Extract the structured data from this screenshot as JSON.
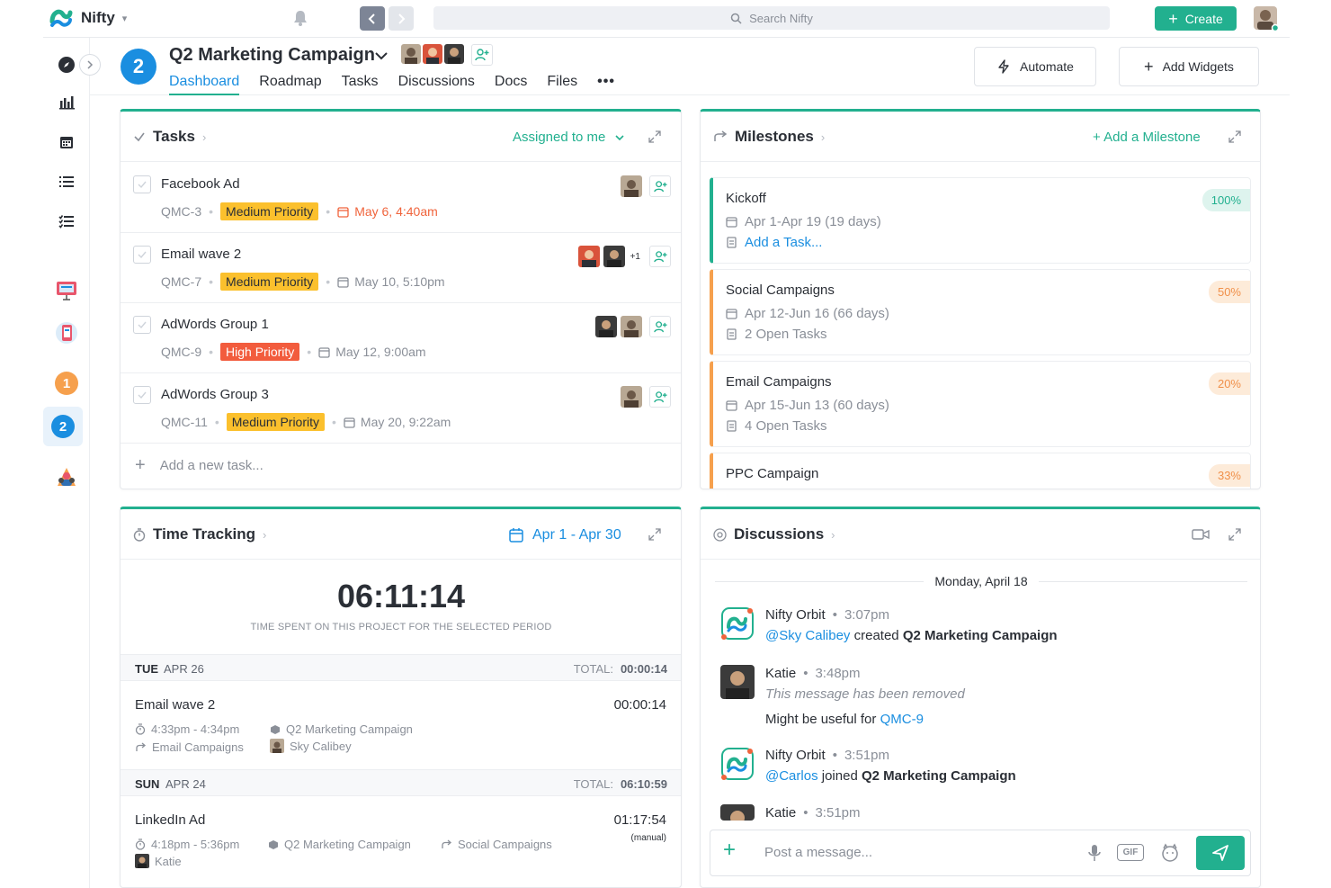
{
  "app": {
    "brand": "Nifty",
    "search_placeholder": "Search Nifty",
    "create_label": "Create"
  },
  "project": {
    "badge": "2",
    "title": "Q2 Marketing Campaign",
    "tabs": [
      "Dashboard",
      "Roadmap",
      "Tasks",
      "Discussions",
      "Docs",
      "Files"
    ],
    "more": "•••",
    "automate_label": "Automate",
    "add_widgets_label": "Add Widgets"
  },
  "sidebar": {
    "project_badge_orange": "1",
    "project_badge_blue": "2"
  },
  "tasks": {
    "title": "Tasks",
    "filter": "Assigned to me",
    "items": [
      {
        "name": "Facebook Ad",
        "id": "QMC-3",
        "priority": "Medium Priority",
        "due": "May 6, 4:40am"
      },
      {
        "name": "Email wave 2",
        "id": "QMC-7",
        "priority": "Medium Priority",
        "due": "May 10, 5:10pm",
        "extra": "+1"
      },
      {
        "name": "AdWords Group 1",
        "id": "QMC-9",
        "priority": "High Priority",
        "due": "May 12, 9:00am"
      },
      {
        "name": "AdWords Group 3",
        "id": "QMC-11",
        "priority": "Medium Priority",
        "due": "May 20, 9:22am"
      }
    ],
    "add_task": "Add a new task..."
  },
  "milestones": {
    "title": "Milestones",
    "add_label": "+ Add a Milestone",
    "items": [
      {
        "name": "Kickoff",
        "dates": "Apr 1-Apr 19 (19 days)",
        "tasks": "Add a Task...",
        "pct": "100%"
      },
      {
        "name": "Social Campaigns",
        "dates": "Apr 12-Jun 16 (66 days)",
        "tasks": "2 Open Tasks",
        "pct": "50%"
      },
      {
        "name": "Email Campaigns",
        "dates": "Apr 15-Jun 13 (60 days)",
        "tasks": "4 Open Tasks",
        "pct": "20%"
      },
      {
        "name": "PPC Campaign",
        "pct": "33%"
      }
    ]
  },
  "time_tracking": {
    "title": "Time Tracking",
    "range": "Apr 1 - Apr 30",
    "total": "06:11:14",
    "caption": "TIME SPENT ON THIS PROJECT FOR THE SELECTED PERIOD",
    "days": [
      {
        "day": "TUE",
        "date": "APR 26",
        "total_label": "TOTAL:",
        "total": "00:00:14",
        "entry": {
          "name": "Email wave 2",
          "duration": "00:00:14",
          "time": "4:33pm - 4:34pm",
          "project": "Q2 Marketing Campaign",
          "milestone": "Email Campaigns",
          "user": "Sky Calibey"
        }
      },
      {
        "day": "SUN",
        "date": "APR 24",
        "total_label": "TOTAL:",
        "total": "06:10:59",
        "entry": {
          "name": "LinkedIn Ad",
          "duration": "01:17:54",
          "note": "(manual)",
          "time": "4:18pm - 5:36pm",
          "project": "Q2 Marketing Campaign",
          "milestone": "Social Campaigns",
          "user": "Katie"
        }
      }
    ]
  },
  "discussions": {
    "title": "Discussions",
    "day": "Monday, April 18",
    "messages": [
      {
        "author": "Nifty Orbit",
        "time": "3:07pm",
        "mention": "@Sky Calibey",
        "verb": "created",
        "object": "Q2 Marketing Campaign"
      },
      {
        "author": "Katie",
        "time": "3:48pm",
        "removed": "This message has been removed",
        "text": "Might be useful for",
        "link": "QMC-9"
      },
      {
        "author": "Nifty Orbit",
        "time": "3:51pm",
        "mention": "@Carlos",
        "verb": "joined",
        "object": "Q2 Marketing Campaign"
      },
      {
        "author": "Katie",
        "time": "3:51pm"
      }
    ],
    "composer_placeholder": "Post a message...",
    "gif": "GIF"
  },
  "colors": {
    "accent": "#22b08f",
    "link": "#1a8ee0",
    "medium_priority": "#fbc02d",
    "high_priority": "#f25c3d",
    "overdue": "#f0643c"
  }
}
